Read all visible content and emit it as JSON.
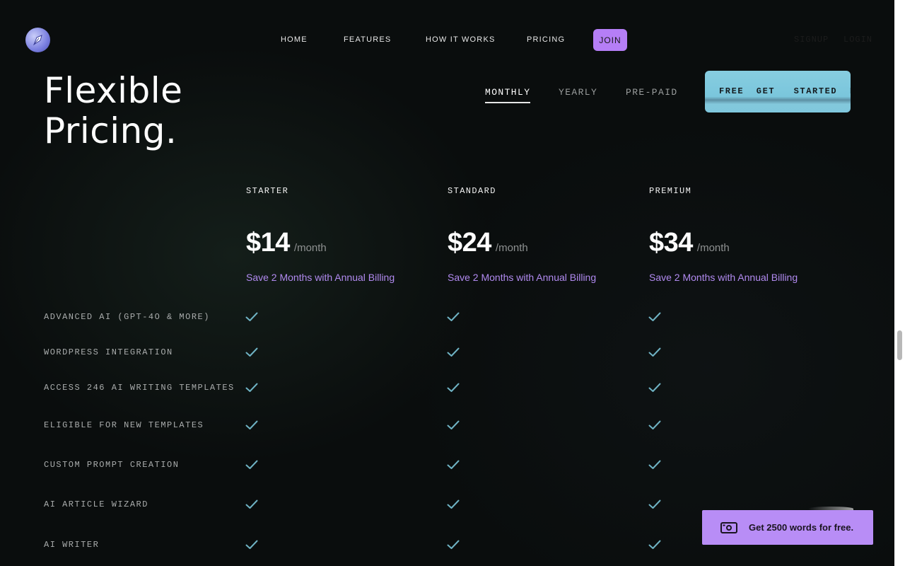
{
  "nav": {
    "links": [
      "HOME",
      "FEATURES",
      "HOW IT WORKS",
      "PRICING"
    ],
    "join_label": "JOIN",
    "signup_label": "SIGNUP",
    "login_label": "LOGIN",
    "accent_color": "#b57ef6"
  },
  "hero": {
    "title_line1": "Flexible",
    "title_line2": "Pricing."
  },
  "billing": {
    "options": [
      "MONTHLY",
      "YEARLY",
      "PRE-PAID"
    ],
    "selected": "MONTHLY",
    "cta_label": "FREE  GET   STARTED  F"
  },
  "plans": [
    {
      "name": "STARTER",
      "price": "$14",
      "period": "/month",
      "save": "Save 2 Months with Annual Billing"
    },
    {
      "name": "STANDARD",
      "price": "$24",
      "period": "/month",
      "save": "Save 2 Months with Annual Billing"
    },
    {
      "name": "PREMIUM",
      "price": "$34",
      "period": "/month",
      "save": "Save 2 Months with Annual Billing"
    }
  ],
  "features": [
    {
      "label": "ADVANCED AI (GPT-4O & MORE)",
      "starter": true,
      "standard": true,
      "premium": true
    },
    {
      "label": "WORDPRESS INTEGRATION",
      "starter": true,
      "standard": true,
      "premium": true
    },
    {
      "label": "ACCESS 246 AI WRITING TEMPLATES",
      "starter": true,
      "standard": true,
      "premium": true
    },
    {
      "label": "ELIGIBLE FOR NEW TEMPLATES",
      "starter": true,
      "standard": true,
      "premium": true
    },
    {
      "label": "CUSTOM PROMPT CREATION",
      "starter": true,
      "standard": true,
      "premium": true
    },
    {
      "label": "AI ARTICLE WIZARD",
      "starter": true,
      "standard": true,
      "premium": true
    },
    {
      "label": "AI WRITER",
      "starter": true,
      "standard": true,
      "premium": true
    }
  ],
  "promo": {
    "label": "Get 2500 words for free.",
    "icon": "money-icon"
  },
  "colors": {
    "check": "#6fb3c4",
    "save_text": "#b18af0",
    "cta_blue": "#87cde0",
    "promo_bg": "#b88df6"
  }
}
